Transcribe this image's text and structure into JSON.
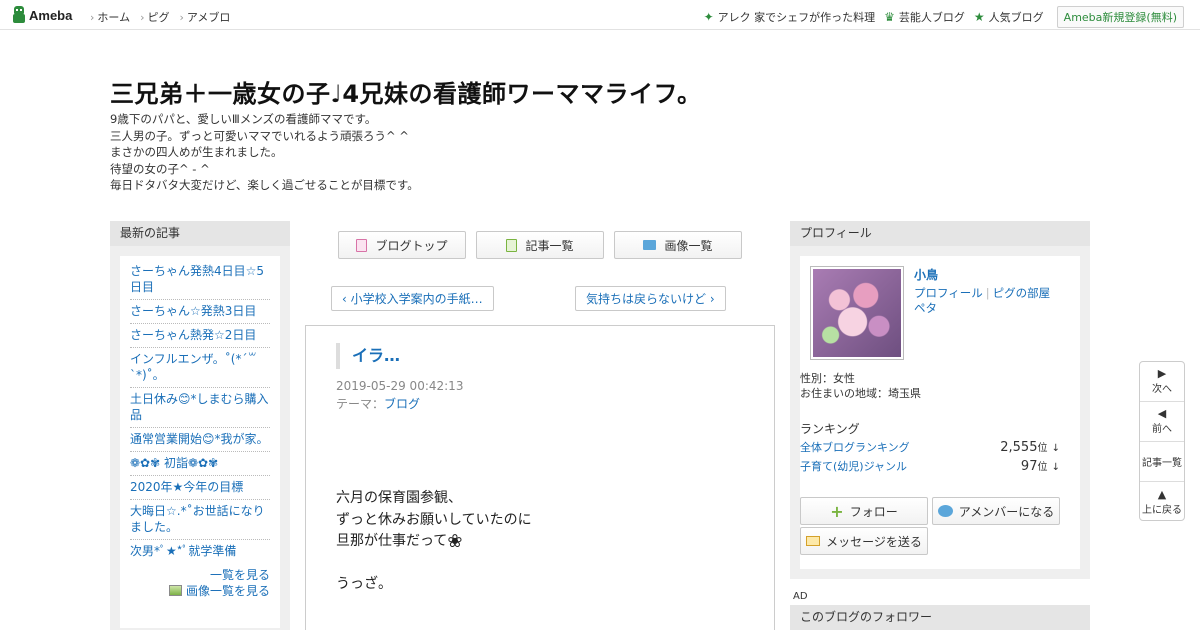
{
  "topbar": {
    "logo_text": "Ameba",
    "nav": [
      "ホーム",
      "ピグ",
      "アメブロ"
    ],
    "right_links": [
      {
        "icon": "sparkle-icon",
        "label": "アレク 家でシェフが作った料理"
      },
      {
        "icon": "crown-icon",
        "label": "芸能人ブログ"
      },
      {
        "icon": "star-icon",
        "label": "人気ブログ"
      }
    ],
    "register_label": "Ameba新規登録(無料)"
  },
  "header": {
    "title": "三兄弟＋一歳女の子♩4兄妹の看護師ワーママライフ。",
    "description": [
      "9歳下のパパと、愛しいⅢメンズの看護師ママです。",
      "三人男の子。ずっと可愛いママでいれるよう頑張ろう^ ^",
      "まさかの四人めが生まれました。",
      "待望の女の子^ - ^",
      "毎日ドタバタ大変だけど、楽しく過ごせることが目標です。"
    ]
  },
  "left_sidebar": {
    "heading": "最新の記事",
    "items": [
      "さーちゃん発熱4日目☆5日目",
      "さーちゃん☆発熱3日目",
      "さーちゃん熱発☆2日目",
      "インフルエンザ。˚(*´꒳`*)˚。",
      "土日休み😊*しまむら購入品",
      "通常営業開始😊*我が家。",
      "❁✿✾ 初詣❁✿✾",
      "2020年★今年の目標",
      "大晦日☆.*˚お世話になりました。",
      "次男*ﾟ★*ﾟ就学準備"
    ],
    "see_all": "一覧を見る",
    "see_images": "画像一覧を見る"
  },
  "center": {
    "nav_buttons": [
      "ブログトップ",
      "記事一覧",
      "画像一覧"
    ],
    "prev_label": "‹ 小学校入学案内の手紙…",
    "next_label": "気持ちは戻らないけど ›",
    "article": {
      "title": "イラ…",
      "date": "2019-05-29 00:42:13",
      "theme_prefix": "テーマ：",
      "theme": "ブログ",
      "lines": [
        "六月の保育園参観、",
        "ずっと休みお願いしていたのに",
        "旦那が仕事だって",
        "",
        "うっざ。"
      ],
      "flower": "❀"
    }
  },
  "right_sidebar": {
    "heading": "プロフィール",
    "name": "小鳥",
    "links": [
      "プロフィール",
      "ピグの部屋",
      "ペタ"
    ],
    "info": [
      "性別：女性",
      "お住まいの地域：埼玉県"
    ],
    "ranking_heading": "ランキング",
    "rankings": [
      {
        "label": "全体ブログランキング",
        "value": "2,555",
        "unit": "位",
        "trend": "↓"
      },
      {
        "label": "子育て(幼児)ジャンル",
        "value": "97",
        "unit": "位",
        "trend": "↓"
      }
    ],
    "follow_label": "フォロー",
    "amember_label": "アメンバーになる",
    "message_label": "メッセージを送る",
    "ad_label": "AD",
    "followers_heading": "このブログのフォロワー"
  },
  "float_nav": [
    "次へ",
    "前へ",
    "記事一覧",
    "上に戻る"
  ]
}
